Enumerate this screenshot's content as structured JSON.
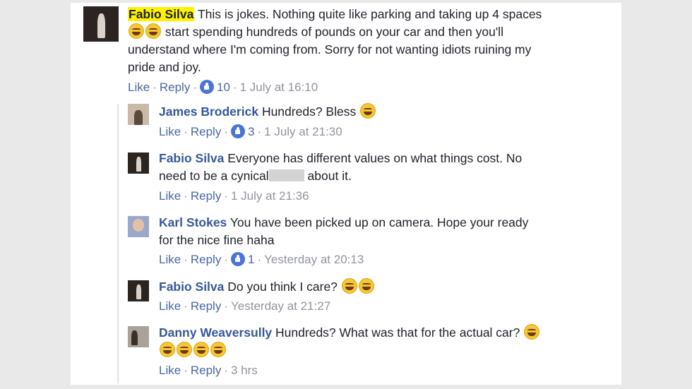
{
  "comments": [
    {
      "name": "Fabio Silva",
      "text1": "This is jokes. Nothing quite like parking and taking up 4 spaces",
      "text2": "start spending hundreds of pounds on your car and then you'll",
      "text3": "understand where I'm coming from. Sorry for not wanting idiots ruining my",
      "text4": "pride and joy.",
      "like": "Like",
      "reply": "Reply",
      "likes": "10",
      "time": "1 July at 16:10"
    },
    {
      "name": "James Broderick",
      "text": "Hundreds? Bless",
      "like": "Like",
      "reply": "Reply",
      "likes": "3",
      "time": "1 July at 21:30"
    },
    {
      "name": "Fabio Silva",
      "text1": "Everyone has different values on what things cost. No",
      "text2a": "need to be a cynical",
      "text2b": "about it.",
      "like": "Like",
      "reply": "Reply",
      "time": "1 July at 21:36"
    },
    {
      "name": "Karl Stokes",
      "text1": "You have been picked up on camera. Hope your ready",
      "text2": "for the nice fine haha",
      "like": "Like",
      "reply": "Reply",
      "likes": "1",
      "time": "Yesterday at 20:13"
    },
    {
      "name": "Fabio Silva",
      "text": "Do you think I care?",
      "like": "Like",
      "reply": "Reply",
      "time": "Yesterday at 21:27"
    },
    {
      "name": "Danny Weaversully",
      "text": "Hundreds? What was that for the actual car?",
      "like": "Like",
      "reply": "Reply",
      "time": "3 hrs"
    }
  ],
  "colors": {
    "name": "#365899",
    "highlight": "#fff200",
    "meta": "#90949c",
    "link": "#4b67a1"
  },
  "icons": [
    "tears-of-joy-emoji",
    "like-thumb-icon"
  ]
}
